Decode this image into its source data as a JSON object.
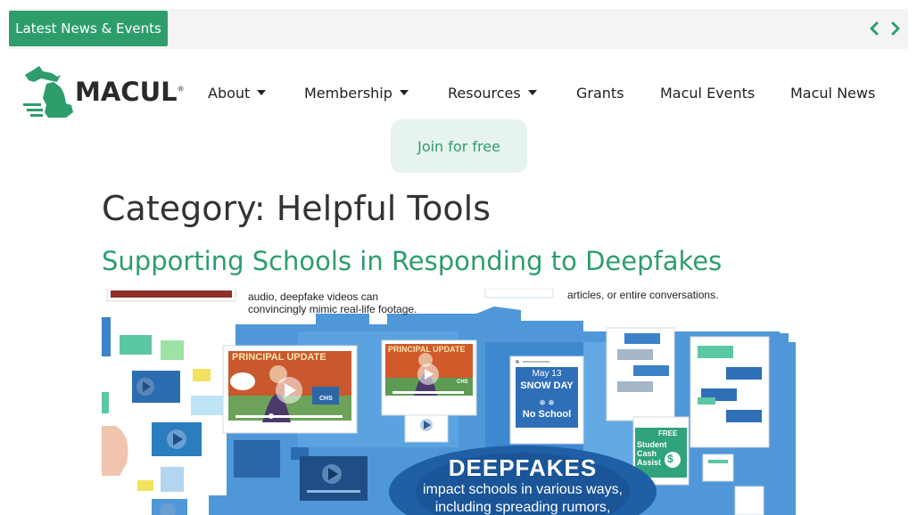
{
  "topbar": {
    "badge_label": "Latest News & Events",
    "prev_icon": "chevron-left-icon",
    "next_icon": "chevron-right-icon",
    "accent_color": "#2e9d6c"
  },
  "header": {
    "logo_text": "MACUL",
    "logo_mark": "®",
    "nav": [
      {
        "label": "About",
        "has_caret": true
      },
      {
        "label": "Membership",
        "has_caret": true
      },
      {
        "label": "Resources",
        "has_caret": true
      },
      {
        "label": "Grants",
        "has_caret": false
      },
      {
        "label": "Macul Events",
        "has_caret": false
      },
      {
        "label": "Macul News",
        "has_caret": false
      }
    ],
    "join_label": "Join for free"
  },
  "main": {
    "category_title": "Category: Helpful Tools",
    "post_title": "Supporting Schools in Responding to Deepfakes",
    "image": {
      "top_text_left_1": "audio, deepfake videos can",
      "top_text_left_2": "convincingly mimic real-life footage.",
      "top_text_right": "articles, or entire conversations.",
      "card1_title": "PRINCIPAL UPDATE",
      "card1_badge": "CHS",
      "card2_title": "PRINCIPAL UPDATE",
      "card2_badge": "CHS",
      "snow_date": "May 13",
      "snow_title": "SNOW DAY",
      "snow_sub": "No School",
      "free_label": "FREE",
      "cash_line1": "Student",
      "cash_line2": "Cash",
      "cash_line3": "Assist",
      "headline": "DEEPFAKES",
      "sub1": "impact schools in various ways,",
      "sub2": "including spreading rumors,"
    }
  }
}
